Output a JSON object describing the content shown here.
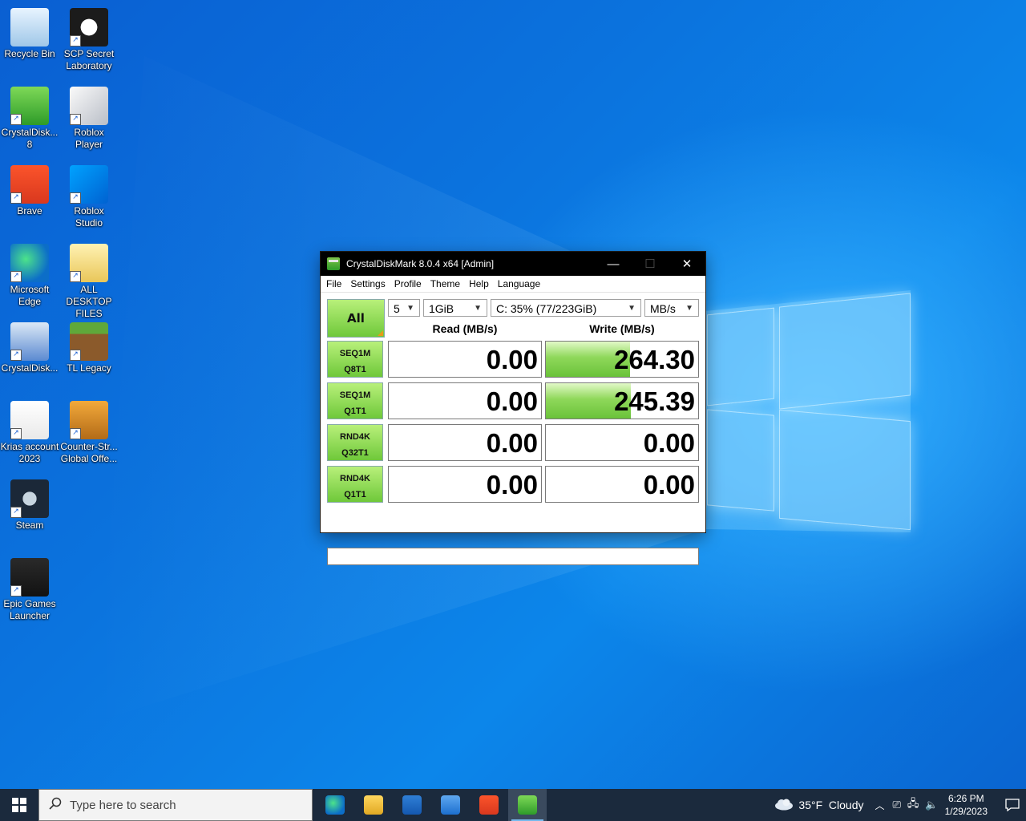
{
  "desktop": {
    "icons": [
      {
        "label": "Recycle Bin",
        "icon": "recycle-bin-icon"
      },
      {
        "label": "SCP Secret Laboratory",
        "icon": "scp-icon"
      },
      {
        "label": "CrystalDisk... 8",
        "icon": "crystaldisk-icon"
      },
      {
        "label": "Roblox Player",
        "icon": "roblox-icon"
      },
      {
        "label": "Brave",
        "icon": "brave-icon"
      },
      {
        "label": "Roblox Studio",
        "icon": "roblox-studio-icon"
      },
      {
        "label": "Microsoft Edge",
        "icon": "edge-icon"
      },
      {
        "label": "ALL DESKTOP FILES",
        "icon": "folder-icon"
      },
      {
        "label": "CrystalDisk...",
        "icon": "crystaldiskinfo-icon"
      },
      {
        "label": "TL Legacy",
        "icon": "minecraft-icon"
      },
      {
        "label": "Krias account 2023",
        "icon": "text-file-icon"
      },
      {
        "label": "Counter-Str... Global Offe...",
        "icon": "csgo-icon"
      },
      {
        "label": "Steam",
        "icon": "steam-icon"
      },
      {
        "label": "Epic Games Launcher",
        "icon": "epic-games-icon"
      }
    ]
  },
  "window": {
    "title": "CrystalDiskMark 8.0.4 x64 [Admin]",
    "controls": {
      "minimize": "—",
      "maximize": "☐",
      "close": "✕"
    },
    "menu": [
      "File",
      "Settings",
      "Profile",
      "Theme",
      "Help",
      "Language"
    ],
    "all_label": "All",
    "count": "5",
    "size": "1GiB",
    "drive": "C: 35% (77/223GiB)",
    "unit": "MB/s",
    "read_header": "Read (MB/s)",
    "write_header": "Write (MB/s)",
    "tests": [
      {
        "line1": "SEQ1M",
        "line2": "Q8T1",
        "read": "0.00",
        "write": "264.30",
        "read_fill": 0,
        "write_fill": 0.55
      },
      {
        "line1": "SEQ1M",
        "line2": "Q1T1",
        "read": "0.00",
        "write": "245.39",
        "read_fill": 0,
        "write_fill": 0.56
      },
      {
        "line1": "RND4K",
        "line2": "Q32T1",
        "read": "0.00",
        "write": "0.00",
        "read_fill": 0,
        "write_fill": 0
      },
      {
        "line1": "RND4K",
        "line2": "Q1T1",
        "read": "0.00",
        "write": "0.00",
        "read_fill": 0,
        "write_fill": 0
      }
    ],
    "comment": ""
  },
  "taskbar": {
    "search_placeholder": "Type here to search",
    "apps": [
      "edge-icon",
      "file-explorer-icon",
      "store-icon",
      "mail-icon",
      "brave-icon",
      "crystaldiskmark-icon"
    ],
    "weather": "35°F  Cloudy",
    "time": "6:26 PM",
    "date": "1/29/2023"
  }
}
